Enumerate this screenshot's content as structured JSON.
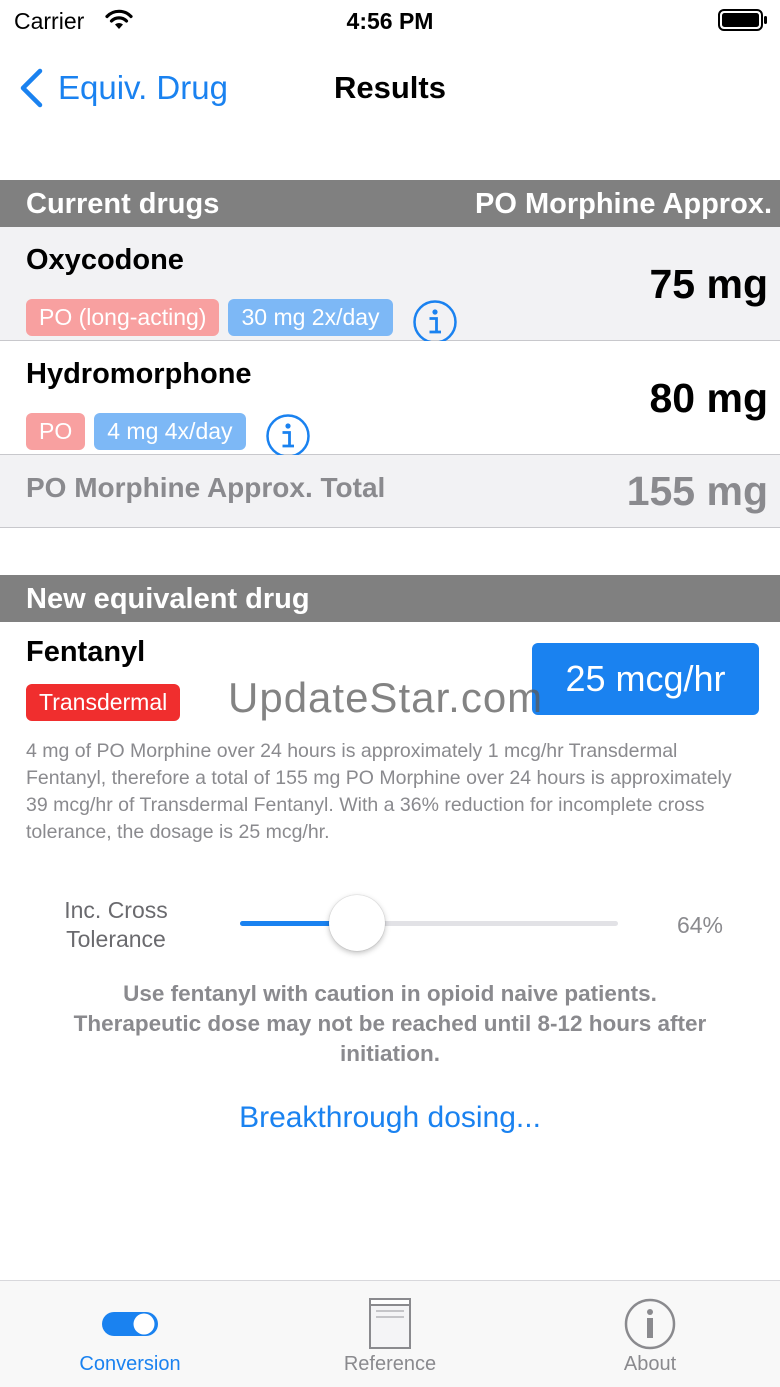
{
  "status_bar": {
    "carrier": "Carrier",
    "time": "4:56 PM"
  },
  "nav": {
    "back_label": "Equiv. Drug",
    "title": "Results"
  },
  "current_section": {
    "header_left": "Current drugs",
    "header_right": "PO Morphine Approx.",
    "drugs": [
      {
        "name": "Oxycodone",
        "route": "PO (long-acting)",
        "regimen": "30 mg 2x/day",
        "equivalent": "75 mg"
      },
      {
        "name": "Hydromorphone",
        "route": "PO",
        "regimen": "4 mg 4x/day",
        "equivalent": "80 mg"
      }
    ],
    "total_label": "PO Morphine Approx. Total",
    "total_value": "155 mg"
  },
  "new_section": {
    "header": "New equivalent drug",
    "drug_name": "Fentanyl",
    "route": "Transdermal",
    "dose": "25 mcg/hr",
    "explanation": "4 mg of PO Morphine over 24 hours is approximately 1 mcg/hr Transdermal Fentanyl, therefore a total of 155 mg PO Morphine over 24 hours is approximately 39 mcg/hr of Transdermal Fentanyl. With a 36% reduction for incomplete cross tolerance, the dosage is 25 mcg/hr.",
    "slider_label": "Inc. Cross Tolerance",
    "slider_value": "64%",
    "slider_fraction": 0.31,
    "caution": "Use fentanyl with caution in opioid naive patients. Therapeutic dose may not be reached until 8-12 hours after initiation.",
    "breakthrough_link": "Breakthrough dosing..."
  },
  "watermark": "UpdateStar.com",
  "tabs": [
    {
      "label": "Conversion",
      "icon": "toggle-icon",
      "active": true
    },
    {
      "label": "Reference",
      "icon": "book-icon",
      "active": false
    },
    {
      "label": "About",
      "icon": "info-icon",
      "active": false
    }
  ],
  "colors": {
    "accent": "#1a82f0",
    "section_header": "#808080",
    "route_tag": "#f8a0a0",
    "regimen_tag": "#7db8f6",
    "transdermal_tag": "#f02e2e",
    "secondary_text": "#8a8a8e"
  }
}
